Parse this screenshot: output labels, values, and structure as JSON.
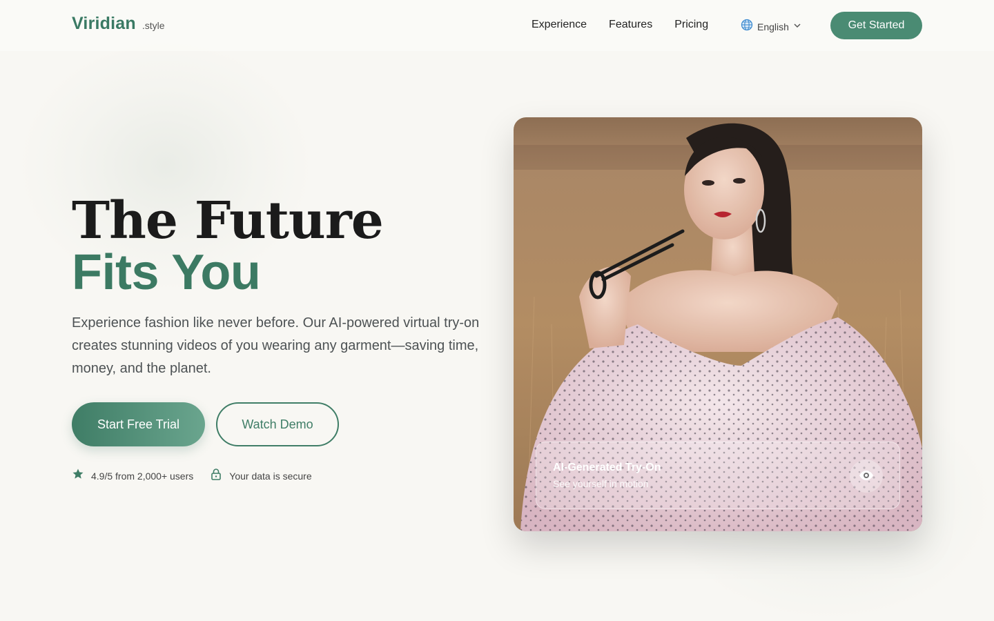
{
  "brand": {
    "name": "Viridian",
    "suffix": ".style",
    "accent": "#3c7a63"
  },
  "nav": {
    "links": [
      "Experience",
      "Features",
      "Pricing"
    ],
    "language": {
      "label": "English",
      "icon": "globe-icon"
    },
    "cta": "Get Started"
  },
  "hero": {
    "title_line1": "The Future",
    "title_line2": "Fits You",
    "subtitle": "Experience fashion like never before. Our AI-powered virtual try-on creates stunning videos of you wearing any garment—saving time, money, and the planet.",
    "primary_cta": "Start Free Trial",
    "secondary_cta": "Watch Demo",
    "trust": [
      {
        "icon": "star-icon",
        "text": "4.9/5 from 2,000+ users"
      },
      {
        "icon": "lock-icon",
        "text": "Your data is secure"
      }
    ]
  },
  "showcase": {
    "overlay_title": "AI-Generated Try-On",
    "overlay_subtitle": "See yourself in motion",
    "action_icon": "eye-icon"
  }
}
